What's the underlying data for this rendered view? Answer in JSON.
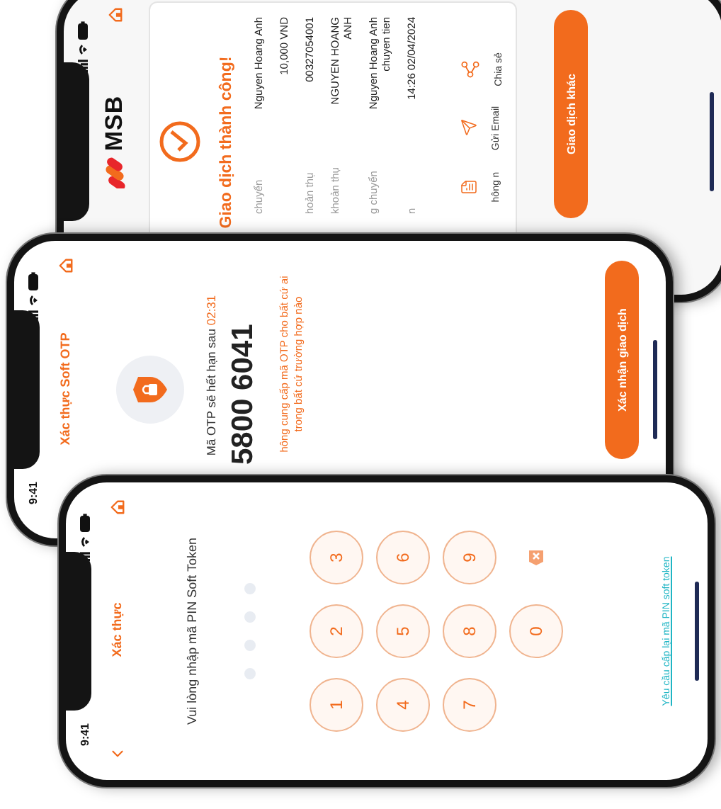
{
  "receipt_screen": {
    "logo": "MSB",
    "title": "Giao dịch thành công!",
    "rows": [
      {
        "label": "chuyển",
        "value": "Nguyen Hoang Anh"
      },
      {
        "value": "10,000 VND"
      },
      {
        "label": "hoản thụ",
        "value": "00327054001"
      },
      {
        "label": "khoản thụ",
        "value": "NGUYEN HOANG ANH"
      },
      {
        "label": "g chuyển",
        "value": "Nguyen Hoang Anh chuyen tien"
      },
      {
        "label": "n",
        "value": "14:26 02/04/2024"
      }
    ],
    "actions": [
      {
        "kind": "info",
        "label": "hông n"
      },
      {
        "kind": "email",
        "label": "Gửi Email"
      },
      {
        "kind": "share",
        "label": "Chia sẻ"
      }
    ],
    "button": "Giao dịch khác"
  },
  "otp_screen": {
    "time": "9:41",
    "title": "Xác thực Soft OTP",
    "expiry_label": "Mã OTP sẽ hết hạn sau",
    "expiry_time": "02:31",
    "code": "5800 6041",
    "warning": "hông cung cấp mã OTP cho bất cứ ai trong bất cứ trường hợp nào",
    "button": "Xác nhận giao dịch"
  },
  "pin_screen": {
    "time": "9:41",
    "title": "Xác thực",
    "prompt": "Vui lòng nhập mã PIN Soft Token",
    "pin_dots": [
      {
        "filled": false
      },
      {
        "filled": false
      },
      {
        "filled": false
      },
      {
        "filled": false
      }
    ],
    "keys": [
      {
        "kind": "digit",
        "label": "1"
      },
      {
        "kind": "digit",
        "label": "2"
      },
      {
        "kind": "digit",
        "label": "3"
      },
      {
        "kind": "digit",
        "label": "4"
      },
      {
        "kind": "digit",
        "label": "5"
      },
      {
        "kind": "digit",
        "label": "6"
      },
      {
        "kind": "digit",
        "label": "7"
      },
      {
        "kind": "digit",
        "label": "8"
      },
      {
        "kind": "digit",
        "label": "9"
      },
      {
        "kind": "blank"
      },
      {
        "kind": "digit",
        "label": "0"
      },
      {
        "kind": "delete"
      }
    ],
    "link": "Yêu cầu cấp lại mã PIN soft token"
  }
}
